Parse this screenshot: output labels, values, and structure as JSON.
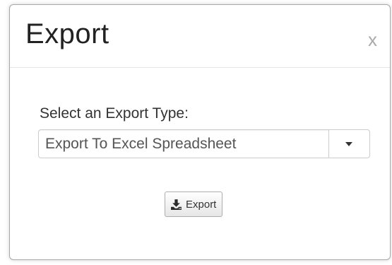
{
  "modal": {
    "title": "Export",
    "close_label": "x"
  },
  "form": {
    "label": "Select an Export Type:",
    "select_value": "Export To Excel Spreadsheet",
    "export_button_label": "Export"
  },
  "icons": {
    "close": "close-icon",
    "dropdown": "chevron-down-icon",
    "download": "download-icon"
  }
}
